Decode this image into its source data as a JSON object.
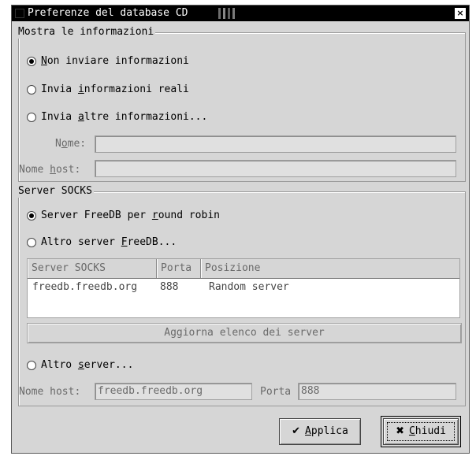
{
  "window": {
    "title": "Preferenze del database CD",
    "close_glyph": "×"
  },
  "info_group": {
    "title": "Mostra le informazioni",
    "options": [
      {
        "pre": "",
        "mnemonic": "N",
        "post": "on inviare informazioni",
        "checked": true
      },
      {
        "pre": "Invia ",
        "mnemonic": "i",
        "post": "nformazioni reali",
        "checked": false
      },
      {
        "pre": "Invia ",
        "mnemonic": "a",
        "post": "ltre informazioni...",
        "checked": false
      }
    ],
    "name_label": {
      "pre": "N",
      "mnemonic": "o",
      "post": "me:"
    },
    "name_value": "",
    "host_label": {
      "pre": "Nome ",
      "mnemonic": "h",
      "post": "ost:"
    },
    "host_value": ""
  },
  "socks_group": {
    "title": "Server SOCKS",
    "options": [
      {
        "pre": "Server FreeDB per ",
        "mnemonic": "r",
        "post": "ound robin",
        "checked": true
      },
      {
        "pre": "Altro server ",
        "mnemonic": "F",
        "post": "reeDB...",
        "checked": false
      }
    ],
    "table": {
      "columns": [
        "Server SOCKS",
        "Porta",
        "Posizione"
      ],
      "rows": [
        {
          "server": "freedb.freedb.org",
          "port": "888",
          "location": "Random server"
        }
      ]
    },
    "update_button": "Aggiorna elenco dei server",
    "other_server": {
      "pre": "Altro ",
      "mnemonic": "s",
      "post": "erver...",
      "checked": false
    },
    "host_label": "Nome host:",
    "host_value": "freedb.freedb.org",
    "port_label": "Porta",
    "port_value": "888"
  },
  "buttons": {
    "apply": {
      "icon": "✔",
      "mnemonic": "A",
      "rest": "pplica"
    },
    "close": {
      "icon": "✖",
      "mnemonic": "C",
      "rest": "hiudi"
    }
  }
}
